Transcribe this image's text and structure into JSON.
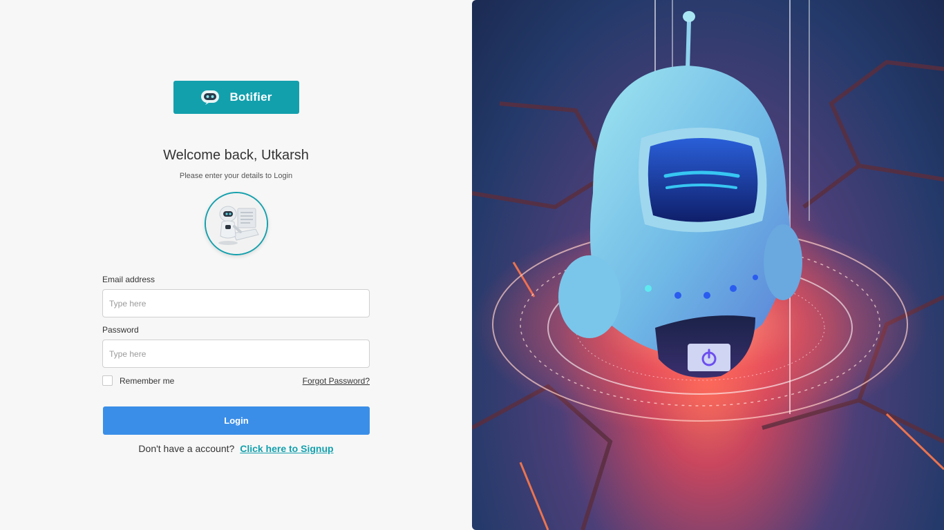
{
  "brand": {
    "name": "Botifier",
    "color": "#13a0ad"
  },
  "heading": {
    "title": "Welcome back, Utkarsh",
    "subtitle": "Please enter your details to Login"
  },
  "avatar": {
    "icon": "robot-avatar-icon"
  },
  "form": {
    "email_label": "Email address",
    "email_placeholder": "Type here",
    "email_value": "",
    "password_label": "Password",
    "password_placeholder": "Type here",
    "password_value": "",
    "remember_label": "Remember me",
    "remember_checked": false,
    "forgot_label": "Forgot Password?",
    "login_label": "Login",
    "login_color": "#3a8ee8"
  },
  "signup": {
    "prompt": "Don't have a account?",
    "link_label": "Click here to Signup"
  },
  "hero": {
    "icon": "robot-hero-illustration",
    "power_icon": "power-icon"
  }
}
